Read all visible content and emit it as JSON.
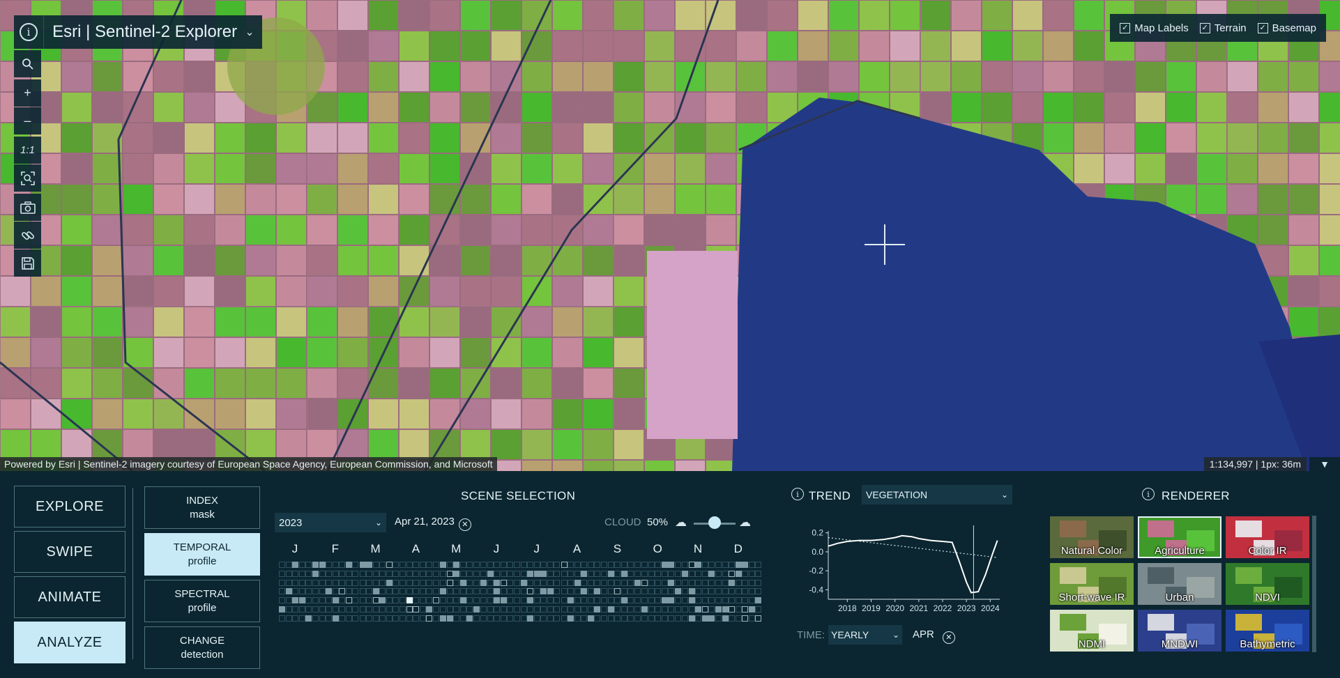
{
  "app": {
    "title": "Esri | Sentinel-2 Explorer"
  },
  "layers": [
    {
      "label": "Map Labels",
      "checked": true
    },
    {
      "label": "Terrain",
      "checked": true
    },
    {
      "label": "Basemap",
      "checked": true
    }
  ],
  "map_tools": {
    "scale_reset_label": "1:1"
  },
  "attribution": "Powered by Esri | Sentinel-2 imagery courtesy of European Space Agency, European Commission, and Microsoft",
  "scale_readout": "1:134,997 | 1px: 36m",
  "modes": [
    {
      "label": "EXPLORE",
      "active": false
    },
    {
      "label": "SWIPE",
      "active": false
    },
    {
      "label": "ANIMATE",
      "active": false
    },
    {
      "label": "ANALYZE",
      "active": true
    }
  ],
  "analysis_tools": [
    {
      "line1": "INDEX",
      "line2": "mask",
      "active": false
    },
    {
      "line1": "TEMPORAL",
      "line2": "profile",
      "active": true
    },
    {
      "line1": "SPECTRAL",
      "line2": "profile",
      "active": false
    },
    {
      "line1": "CHANGE",
      "line2": "detection",
      "active": false
    }
  ],
  "scene_selection": {
    "title": "SCENE SELECTION",
    "year": "2023",
    "selected_date": "Apr 21, 2023",
    "cloud_label": "CLOUD",
    "cloud_value": "50%",
    "cloud_fraction": 0.5,
    "months": [
      "J",
      "F",
      "M",
      "A",
      "M",
      "J",
      "J",
      "A",
      "S",
      "O",
      "N",
      "D"
    ]
  },
  "trend": {
    "title": "TREND",
    "index": "VEGETATION",
    "time_label": "TIME:",
    "time_value": "YEARLY",
    "month_value": "APR"
  },
  "chart_data": {
    "type": "line",
    "x_ticks": [
      "2018",
      "2019",
      "2020",
      "2021",
      "2022",
      "2023",
      "2024"
    ],
    "y_ticks": [
      "0.2",
      "0.0",
      "-0.2",
      "-0.4"
    ],
    "ylim": [
      -0.5,
      0.22
    ],
    "xlim": [
      2017.2,
      2024.4
    ],
    "series": [
      {
        "x": [
          2017.2,
          2017.6,
          2018.0,
          2018.5,
          2019.0,
          2019.5,
          2020.0,
          2020.3,
          2020.7,
          2021.0,
          2021.5,
          2022.0,
          2022.4,
          2022.7,
          2023.0,
          2023.2,
          2023.5,
          2023.8,
          2024.1,
          2024.3
        ],
        "y": [
          0.06,
          0.09,
          0.11,
          0.12,
          0.12,
          0.13,
          0.15,
          0.17,
          0.16,
          0.14,
          0.12,
          0.11,
          0.1,
          -0.1,
          -0.32,
          -0.43,
          -0.42,
          -0.24,
          -0.02,
          0.12
        ]
      },
      {
        "x": [
          2017.2,
          2024.3
        ],
        "y": [
          0.15,
          -0.06
        ],
        "style": "dotted"
      }
    ],
    "marker_x": 2023.3
  },
  "renderer": {
    "title": "RENDERER",
    "tiles": [
      {
        "label": "Natural Color",
        "colors": [
          "#5b6a3c",
          "#8a6a4a",
          "#3e4f2b"
        ],
        "active": false
      },
      {
        "label": "Agriculture",
        "colors": [
          "#3f9a2a",
          "#c0708a",
          "#59c23b"
        ],
        "active": true
      },
      {
        "label": "Color IR",
        "colors": [
          "#c2303f",
          "#e6dde2",
          "#9a2a40"
        ],
        "active": false
      },
      {
        "label": "Short-wave IR",
        "colors": [
          "#6f9c3a",
          "#c8c890",
          "#52782c"
        ],
        "active": false
      },
      {
        "label": "Urban",
        "colors": [
          "#7a8a8f",
          "#4e5f66",
          "#9aa6a3"
        ],
        "active": false
      },
      {
        "label": "NDVI",
        "colors": [
          "#2f7a2a",
          "#6cae3e",
          "#1f5a22"
        ],
        "active": false
      },
      {
        "label": "NDMI",
        "colors": [
          "#d9e3c8",
          "#6ba33a",
          "#f2f2e6"
        ],
        "active": false
      },
      {
        "label": "MNDWI",
        "colors": [
          "#2b3f8c",
          "#d4d6e0",
          "#4a63b5"
        ],
        "active": false
      },
      {
        "label": "Bathymetric",
        "colors": [
          "#1c3f9c",
          "#c9b23a",
          "#2d5bc4"
        ],
        "active": false
      }
    ]
  },
  "colors": {
    "accent": "#c8eaf6",
    "panel_bg": "#0b2630",
    "water": "#223a86",
    "crop_green": "#59c23b",
    "crop_pink": "#b07a94"
  }
}
